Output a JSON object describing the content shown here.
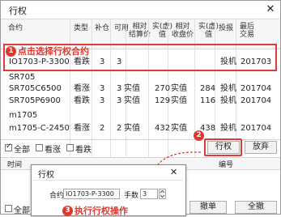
{
  "window": {
    "title": "行权",
    "close": "✕"
  },
  "table": {
    "headers": [
      "合约",
      "类型",
      "补仓",
      "可用",
      "相对\n结算价",
      "实(虚)\n值",
      "相对\n收盘价",
      "实(虚)\n值",
      "投报",
      "最后\n交易"
    ],
    "rows": [
      {
        "contract": "IO1703-P-3300",
        "type": "看跌",
        "a": "3",
        "b": "3",
        "c": "",
        "d": "",
        "e": "",
        "f": "",
        "g": "投机",
        "h": "201703"
      },
      {
        "contract": "SR705",
        "type": "",
        "a": "",
        "b": "",
        "c": "",
        "d": "",
        "e": "",
        "f": "",
        "g": "",
        "h": ""
      },
      {
        "contract": "SR705C6500",
        "type": "看涨",
        "a": "3",
        "b": "3",
        "c": "实值",
        "d": "270",
        "e": "实值",
        "f": "284",
        "g": "投机",
        "h": "201704"
      },
      {
        "contract": "SR705P6900",
        "type": "看跌",
        "a": "3",
        "b": "3",
        "c": "实值",
        "d": "129",
        "e": "实值",
        "f": "116",
        "g": "投机",
        "h": "201704"
      },
      {
        "contract": "m1705",
        "type": "",
        "a": "",
        "b": "",
        "c": "",
        "d": "",
        "e": "",
        "f": "",
        "g": "",
        "h": ""
      },
      {
        "contract": "m1705-C-2450",
        "type": "看涨",
        "a": "2",
        "b": "2",
        "c": "实值",
        "d": "432",
        "e": "实值",
        "f": "438",
        "g": "投机",
        "h": "201704"
      }
    ]
  },
  "annotations": {
    "step1_num": "1",
    "step1_text": "点击选择行权合约",
    "step2_num": "2",
    "step3_num": "3",
    "step3_text": "执行行权操作"
  },
  "filters": {
    "all": "全部",
    "call": "看涨",
    "put": "看跌",
    "all_checked": true
  },
  "buttons": {
    "exercise": "行权",
    "abandon": "放弃",
    "withdraw": "撤单",
    "full": "全撤"
  },
  "orders": {
    "time_header": "时间",
    "code_header": "编号",
    "all_checkbox": "全部"
  },
  "dialog": {
    "title": "行权",
    "close": "✕",
    "contract_label": "合约",
    "contract_value": "IO1703-P-3300",
    "qty_label": "手数",
    "qty_value": "3"
  }
}
